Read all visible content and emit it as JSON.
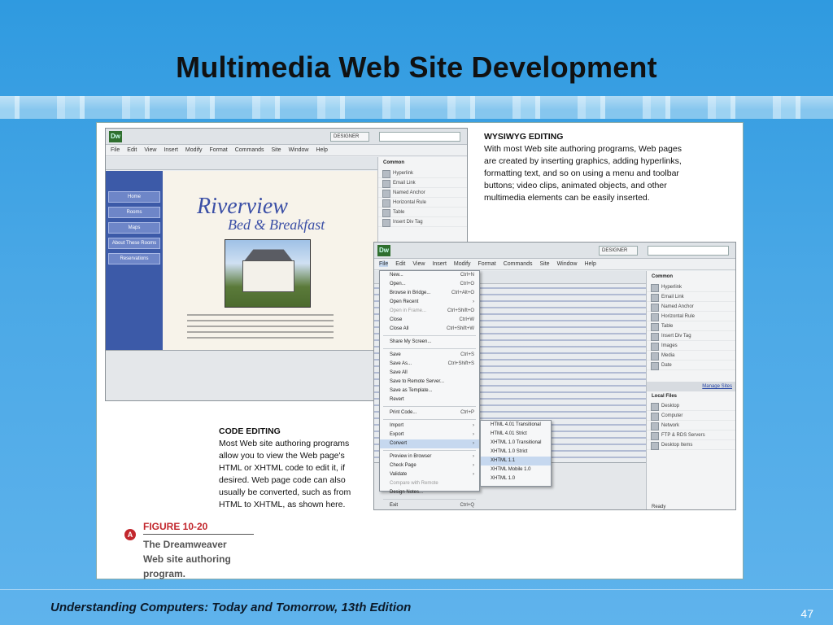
{
  "slide": {
    "title": "Multimedia Web Site Development",
    "footer": "Understanding Computers: Today and Tomorrow, 13th Edition",
    "page_number": "47"
  },
  "captions": {
    "wysiwyg_heading": "WYSIWYG EDITING",
    "wysiwyg_body": "With most Web site authoring programs, Web pages are created by inserting graphics, adding hyperlinks, formatting text, and so on using a menu and toolbar buttons; video clips, animated objects, and other multimedia elements can be easily inserted.",
    "code_heading": "CODE EDITING",
    "code_body": "Most Web site authoring programs allow you to view the Web page's HTML or XHTML code to edit it, if desired. Web page code can also usually be converted, such as from HTML to XHTML, as shown here."
  },
  "figure": {
    "label": "FIGURE 10-20",
    "caption_lines": [
      "The Dreamweaver",
      "Web site authoring",
      "program."
    ]
  },
  "app": {
    "logo": "Dw",
    "designer_label": "DESIGNER",
    "menu": [
      "File",
      "Edit",
      "View",
      "Insert",
      "Modify",
      "Format",
      "Commands",
      "Site",
      "Window",
      "Help"
    ],
    "panel_header": "Common",
    "panel_items": [
      "Hyperlink",
      "Email Link",
      "Named Anchor",
      "Horizontal Rule",
      "Table",
      "Insert Div Tag",
      "Images",
      "Media",
      "Date"
    ],
    "files_header": "Local Files",
    "files_items": [
      "Desktop",
      "Computer",
      "Network",
      "FTP & RDS Servers",
      "Desktop Items"
    ],
    "manage_sites": "Manage Sites",
    "ready": "Ready"
  },
  "site": {
    "logo_line1": "Riverview",
    "logo_line2": "Bed & Breakfast",
    "nav": [
      "Home",
      "Rooms",
      "Maps",
      "About These Rooms",
      "Reservations"
    ]
  },
  "file_menu": {
    "items": [
      {
        "label": "New...",
        "shortcut": "Ctrl+N"
      },
      {
        "label": "Open...",
        "shortcut": "Ctrl+O"
      },
      {
        "label": "Browse in Bridge...",
        "shortcut": "Ctrl+Alt+O"
      },
      {
        "label": "Open Recent",
        "shortcut": ""
      },
      {
        "label": "Open in Frame...",
        "shortcut": "Ctrl+Shift+O"
      },
      {
        "label": "Close",
        "shortcut": "Ctrl+W"
      },
      {
        "label": "Close All",
        "shortcut": "Ctrl+Shift+W"
      },
      {
        "label": "Share My Screen...",
        "shortcut": ""
      },
      {
        "label": "Save",
        "shortcut": "Ctrl+S"
      },
      {
        "label": "Save As...",
        "shortcut": "Ctrl+Shift+S"
      },
      {
        "label": "Save All",
        "shortcut": ""
      },
      {
        "label": "Save to Remote Server...",
        "shortcut": ""
      },
      {
        "label": "Save as Template...",
        "shortcut": ""
      },
      {
        "label": "Revert",
        "shortcut": ""
      },
      {
        "label": "Print Code...",
        "shortcut": "Ctrl+P"
      },
      {
        "label": "Import",
        "shortcut": ""
      },
      {
        "label": "Export",
        "shortcut": ""
      },
      {
        "label": "Convert",
        "shortcut": ""
      },
      {
        "label": "Preview in Browser",
        "shortcut": ""
      },
      {
        "label": "Check Page",
        "shortcut": ""
      },
      {
        "label": "Validate",
        "shortcut": ""
      },
      {
        "label": "Compare with Remote",
        "shortcut": ""
      },
      {
        "label": "Design Notes...",
        "shortcut": ""
      },
      {
        "label": "Exit",
        "shortcut": "Ctrl+Q"
      }
    ],
    "convert_submenu": [
      "HTML 4.01 Transitional",
      "HTML 4.01 Strict",
      "XHTML 1.0 Transitional",
      "XHTML 1.0 Strict",
      "XHTML 1.1",
      "XHTML Mobile 1.0",
      "XHTML 1.0"
    ]
  }
}
